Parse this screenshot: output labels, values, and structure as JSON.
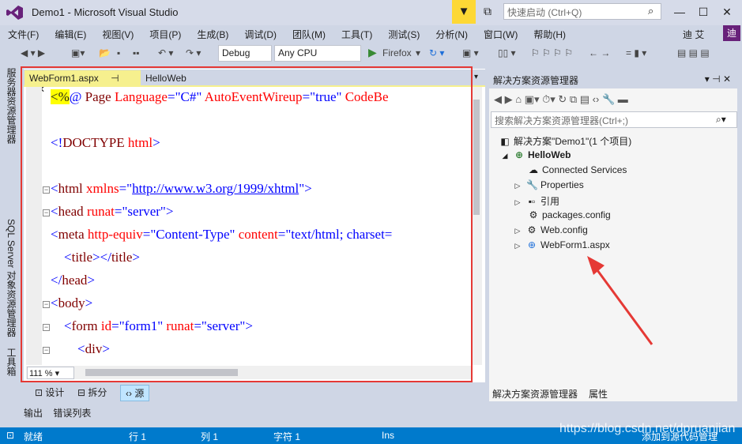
{
  "window": {
    "title": "Demo1 - Microsoft Visual Studio",
    "quick_launch_placeholder": "快速启动 (Ctrl+Q)",
    "user": "迪 艾",
    "avatar": "迪"
  },
  "menu": [
    "文件(F)",
    "编辑(E)",
    "视图(V)",
    "项目(P)",
    "生成(B)",
    "调试(D)",
    "团队(M)",
    "工具(T)",
    "测试(S)",
    "分析(N)",
    "窗口(W)",
    "帮助(H)"
  ],
  "toolbar": {
    "config": "Debug",
    "platform": "Any CPU",
    "browser": "Firefox"
  },
  "left_tabs": [
    "服务器资源管理器",
    "SQL Server 对象资源管理器",
    "工具箱"
  ],
  "editor": {
    "tabs": [
      {
        "label": "WebForm1.aspx",
        "pin": "⊣",
        "close": "✕"
      },
      {
        "label": "HelloWeb"
      }
    ],
    "zoom": "111 %",
    "lines": [
      [
        {
          "c": "hl",
          "t": "<%"
        },
        {
          "c": "v",
          "t": "@ "
        },
        {
          "c": "t",
          "t": "Page "
        },
        {
          "c": "a",
          "t": "Language"
        },
        {
          "c": "v",
          "t": "=\"C#\" "
        },
        {
          "c": "a",
          "t": "AutoEventWireup"
        },
        {
          "c": "v",
          "t": "=\"true\" "
        },
        {
          "c": "a",
          "t": "CodeBe"
        }
      ],
      [],
      [
        {
          "c": "v",
          "t": "<!"
        },
        {
          "c": "t",
          "t": "DOCTYPE "
        },
        {
          "c": "a",
          "t": "html"
        },
        {
          "c": "v",
          "t": ">"
        }
      ],
      [],
      [
        {
          "c": "v",
          "t": "<"
        },
        {
          "c": "t",
          "t": "html "
        },
        {
          "c": "a",
          "t": "xmlns"
        },
        {
          "c": "v",
          "t": "=\""
        },
        {
          "c": "u",
          "t": "http://www.w3.org/1999/xhtml"
        },
        {
          "c": "v",
          "t": "\">"
        }
      ],
      [
        {
          "c": "v",
          "t": "<"
        },
        {
          "c": "t",
          "t": "head "
        },
        {
          "c": "a",
          "t": "runat"
        },
        {
          "c": "v",
          "t": "=\"server\">"
        }
      ],
      [
        {
          "c": "v",
          "t": "<"
        },
        {
          "c": "t",
          "t": "meta "
        },
        {
          "c": "a",
          "t": "http-equiv"
        },
        {
          "c": "v",
          "t": "=\"Content-Type\" "
        },
        {
          "c": "a",
          "t": "content"
        },
        {
          "c": "v",
          "t": "=\"text/html; charset="
        }
      ],
      [
        {
          "c": "v",
          "t": "    <"
        },
        {
          "c": "t",
          "t": "title"
        },
        {
          "c": "v",
          "t": "></"
        },
        {
          "c": "t",
          "t": "title"
        },
        {
          "c": "v",
          "t": ">"
        }
      ],
      [
        {
          "c": "v",
          "t": "</"
        },
        {
          "c": "t",
          "t": "head"
        },
        {
          "c": "v",
          "t": ">"
        }
      ],
      [
        {
          "c": "v",
          "t": "<"
        },
        {
          "c": "t",
          "t": "body"
        },
        {
          "c": "v",
          "t": ">"
        }
      ],
      [
        {
          "c": "v",
          "t": "    <"
        },
        {
          "c": "t",
          "t": "form "
        },
        {
          "c": "a",
          "t": "id"
        },
        {
          "c": "v",
          "t": "=\"form1\" "
        },
        {
          "c": "a",
          "t": "runat"
        },
        {
          "c": "v",
          "t": "=\"server\">"
        }
      ],
      [
        {
          "c": "v",
          "t": "        <"
        },
        {
          "c": "t",
          "t": "div"
        },
        {
          "c": "v",
          "t": ">"
        }
      ]
    ]
  },
  "view_buttons": [
    "设计",
    "拆分",
    "源"
  ],
  "output_tabs": [
    "输出",
    "错误列表"
  ],
  "solution_explorer": {
    "title": "解决方案资源管理器",
    "search_placeholder": "搜索解决方案资源管理器(Ctrl+;)",
    "solution": "解决方案\"Demo1\"(1 个项目)",
    "project": "HelloWeb",
    "items": [
      "Connected Services",
      "Properties",
      "引用",
      "packages.config",
      "Web.config",
      "WebForm1.aspx"
    ],
    "tabs": [
      "解决方案资源管理器",
      "属性"
    ]
  },
  "status": {
    "ready": "就绪",
    "row": "行 1",
    "col": "列 1",
    "char": "字符 1",
    "mode": "Ins",
    "source_control": "添加到源代码管理"
  },
  "watermark": "https://blog.csdn.net/dpruanjian",
  "colors": {
    "status_bar": "#007acc",
    "highlight": "#ffff00",
    "annotation_red": "#e53935",
    "active_tab": "#f6f08e"
  }
}
